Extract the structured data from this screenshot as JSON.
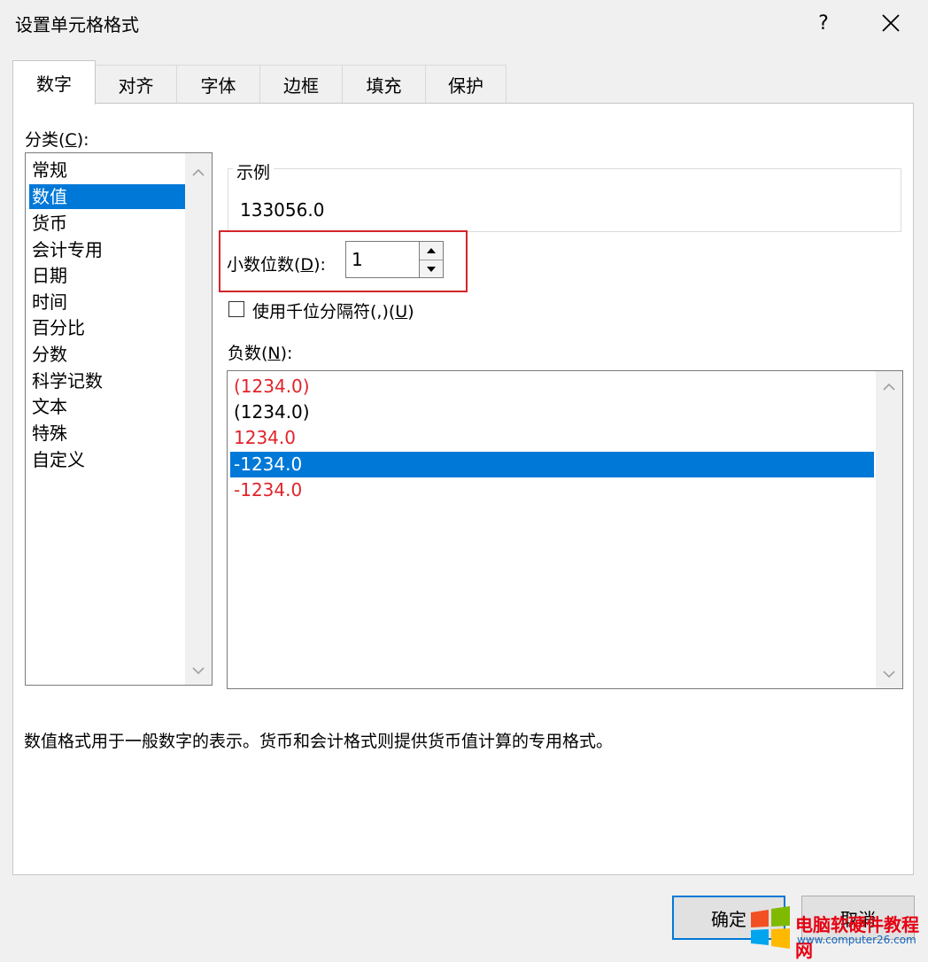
{
  "dialog": {
    "title": "设置单元格格式",
    "help": "?"
  },
  "tabs": [
    {
      "label": "数字",
      "active": true
    },
    {
      "label": "对齐",
      "active": false
    },
    {
      "label": "字体",
      "active": false
    },
    {
      "label": "边框",
      "active": false
    },
    {
      "label": "填充",
      "active": false
    },
    {
      "label": "保护",
      "active": false
    }
  ],
  "category": {
    "label_main": "分类(",
    "label_key": "C",
    "label_end": "):",
    "items": [
      "常规",
      "数值",
      "货币",
      "会计专用",
      "日期",
      "时间",
      "百分比",
      "分数",
      "科学记数",
      "文本",
      "特殊",
      "自定义"
    ],
    "selected": "数值"
  },
  "sample": {
    "title": "示例",
    "value": "133056.0"
  },
  "decimals": {
    "label_main": "小数位数(",
    "label_key": "D",
    "label_end": "):",
    "value": "1"
  },
  "thousands": {
    "label_main": "使用千位分隔符(,)(",
    "label_key": "U",
    "label_end": ")",
    "checked": false
  },
  "negative": {
    "label_main": "负数(",
    "label_key": "N",
    "label_end": "):",
    "items": [
      {
        "text": "(1234.0)",
        "color": "#e0242b"
      },
      {
        "text": "(1234.0)",
        "color": "#000000"
      },
      {
        "text": "1234.0",
        "color": "#e0242b"
      },
      {
        "text": "-1234.0",
        "color": "#ffffff"
      },
      {
        "text": "-1234.0",
        "color": "#e0242b"
      }
    ],
    "selected": "-1234.0"
  },
  "description": "数值格式用于一般数字的表示。货币和会计格式则提供货币值计算的专用格式。",
  "buttons": {
    "ok": "确定",
    "cancel": "取消"
  },
  "watermark": {
    "text": "电脑软硬件教程网",
    "url": "www.computer26.com"
  },
  "colors": {
    "selection": "#0078d7",
    "highlight_box": "#d3252b",
    "negative_red": "#e0242b"
  }
}
